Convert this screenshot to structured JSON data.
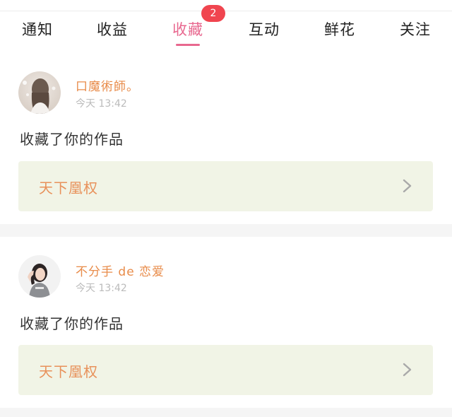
{
  "tabs": [
    {
      "label": "通知"
    },
    {
      "label": "收益"
    },
    {
      "label": "收藏",
      "active": true,
      "badge": "2"
    },
    {
      "label": "互动"
    },
    {
      "label": "鲜花"
    },
    {
      "label": "关注"
    }
  ],
  "notifications": [
    {
      "user_name": "口魔術師。",
      "timestamp": "今天 13:42",
      "action": "收藏了你的作品",
      "work_title": "天下凰权",
      "avatar_icon": "user-avatar-icon"
    },
    {
      "user_name": "不分手 de 恋爱",
      "timestamp": "今天 13:42",
      "action": "收藏了你的作品",
      "work_title": "天下凰权",
      "avatar_icon": "user-avatar-icon"
    }
  ],
  "colors": {
    "accent_pink": "#e8688f",
    "badge_red": "#f0454f",
    "username_orange": "#e88b49",
    "work_title_orange": "#e8915a",
    "work_box_bg": "#f1f4e6",
    "page_bg": "#f5f5f5"
  }
}
